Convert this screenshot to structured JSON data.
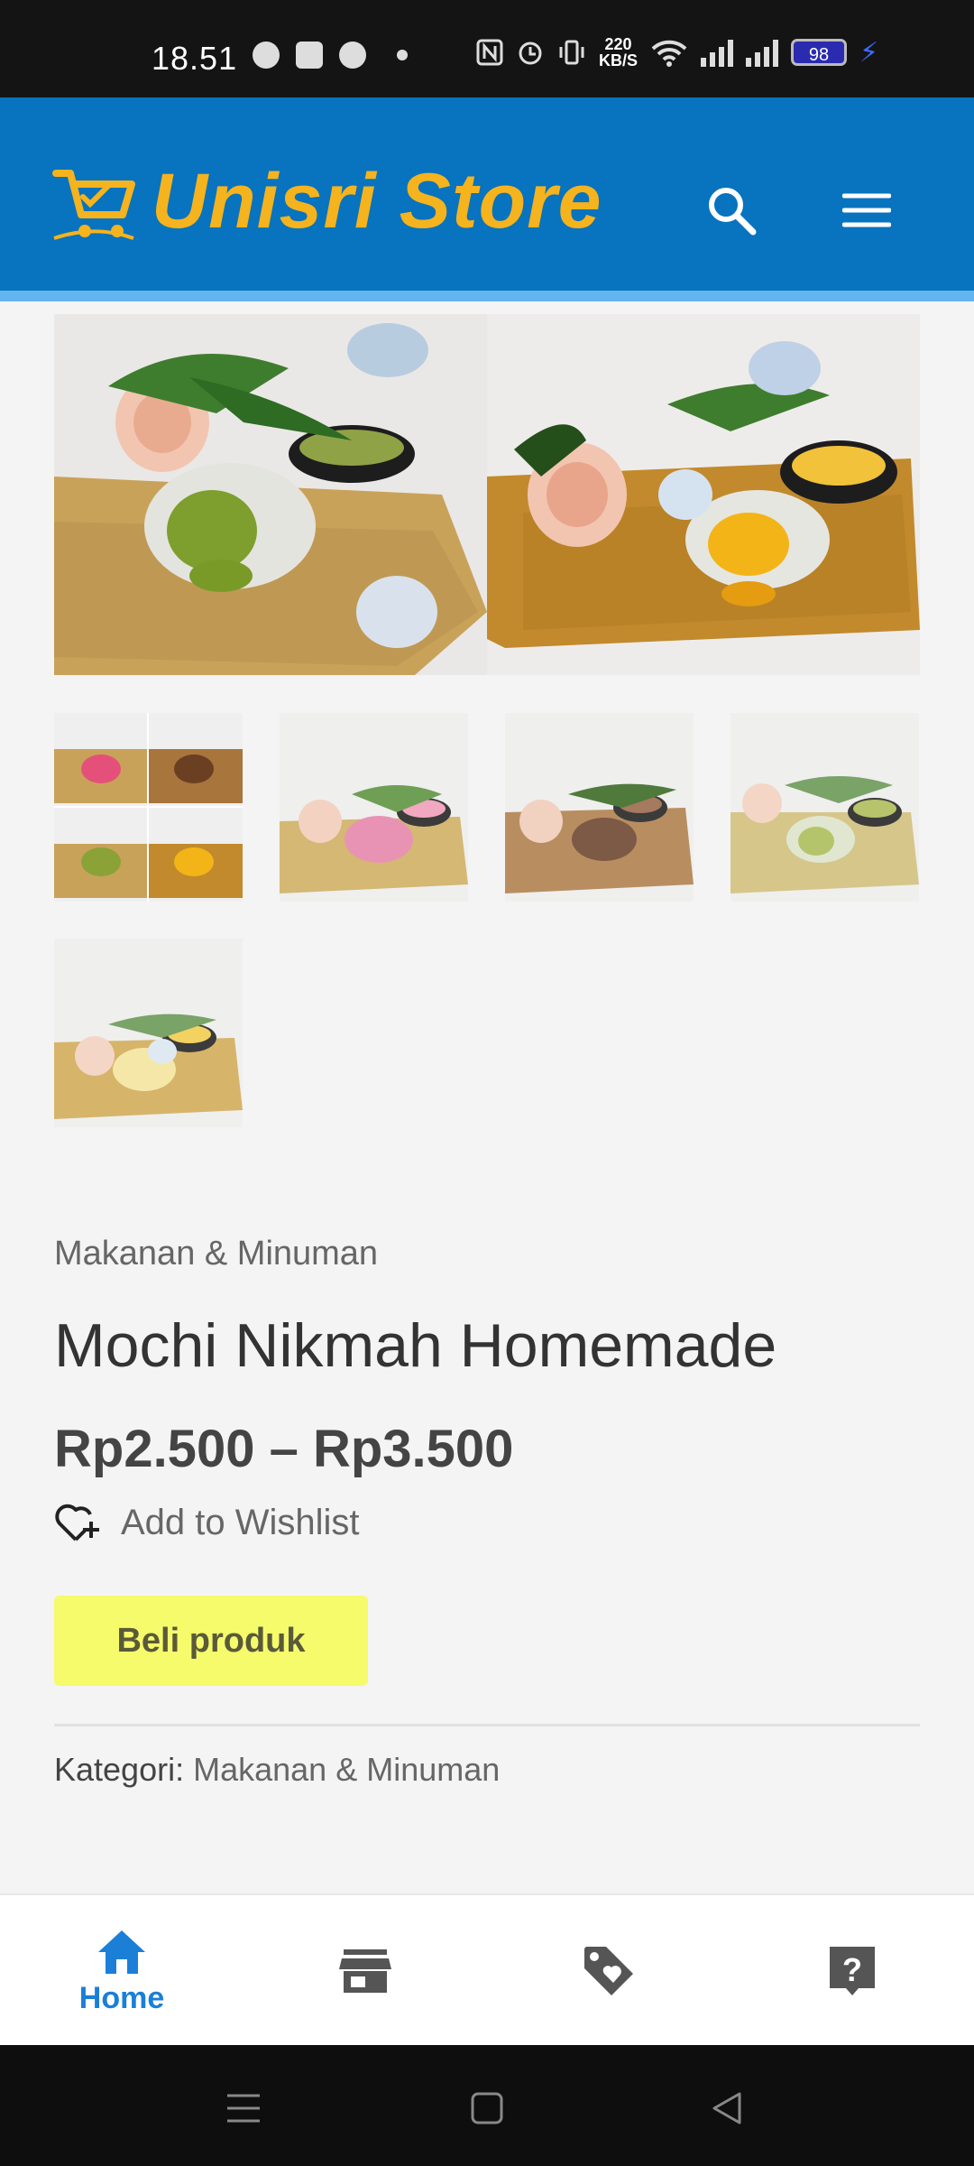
{
  "status_bar": {
    "time": "18.51",
    "net_speed_value": "220",
    "net_speed_unit": "KB/S",
    "battery": "98"
  },
  "header": {
    "brand": "Unisri Store",
    "brand_color": "#f5b31e",
    "background_color": "#0873be"
  },
  "product": {
    "category_label": "Makanan & Minuman",
    "title": "Mochi Nikmah Homemade",
    "price": "Rp2.500 – Rp3.500",
    "wishlist_label": "Add to Wishlist",
    "buy_button_label": "Beli produk",
    "buy_button_color": "#f6fb6c",
    "meta_label": "Kategori:",
    "meta_value": "Makanan & Minuman"
  },
  "gallery": {
    "main_images": [
      "matcha-mochi-photo",
      "cheese-mochi-photo"
    ],
    "thumbnails": [
      "collage-thumbnail",
      "strawberry-mochi-thumbnail",
      "chocolate-mochi-thumbnail",
      "matcha-mochi-thumbnail",
      "cheese-mochi-thumbnail"
    ]
  },
  "bottom_nav": {
    "items": [
      {
        "label": "Home",
        "icon": "home-icon",
        "active": true
      },
      {
        "label": "",
        "icon": "store-icon",
        "active": false
      },
      {
        "label": "",
        "icon": "tag-heart-icon",
        "active": false
      },
      {
        "label": "",
        "icon": "help-icon",
        "active": false
      }
    ],
    "active_color": "#1b7fd8"
  }
}
